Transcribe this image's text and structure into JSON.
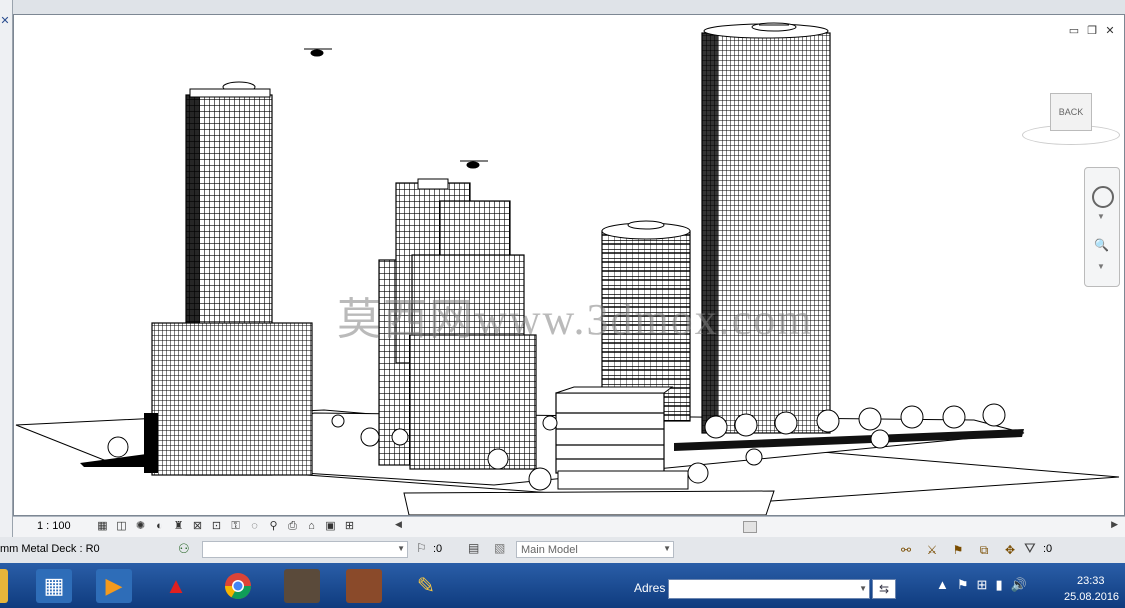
{
  "viewport": {
    "watermark": "莫西网www.3dmox.com",
    "viewcube_label": "BACK"
  },
  "view_control_bar": {
    "scale": "1 : 100"
  },
  "status_bar": {
    "selection_text": "mm Metal Deck : R0",
    "editing_requests": ":0",
    "design_option": "Main Model",
    "filter_count": ":0"
  },
  "taskbar": {
    "address_label": "Adres",
    "time": "23:33",
    "date": "25.08.2016",
    "apps": [
      {
        "icon": "calculator-icon"
      },
      {
        "icon": "media-player-icon"
      },
      {
        "icon": "autocad-icon"
      },
      {
        "icon": "chrome-icon"
      },
      {
        "icon": "game-soldier-icon"
      },
      {
        "icon": "game-character-icon"
      },
      {
        "icon": "pencil-app-icon"
      }
    ]
  },
  "colors": {
    "taskbar": "#1a4a93",
    "viewport_bg": "#ffffff",
    "chrome_bg": "#dfe3e8"
  }
}
